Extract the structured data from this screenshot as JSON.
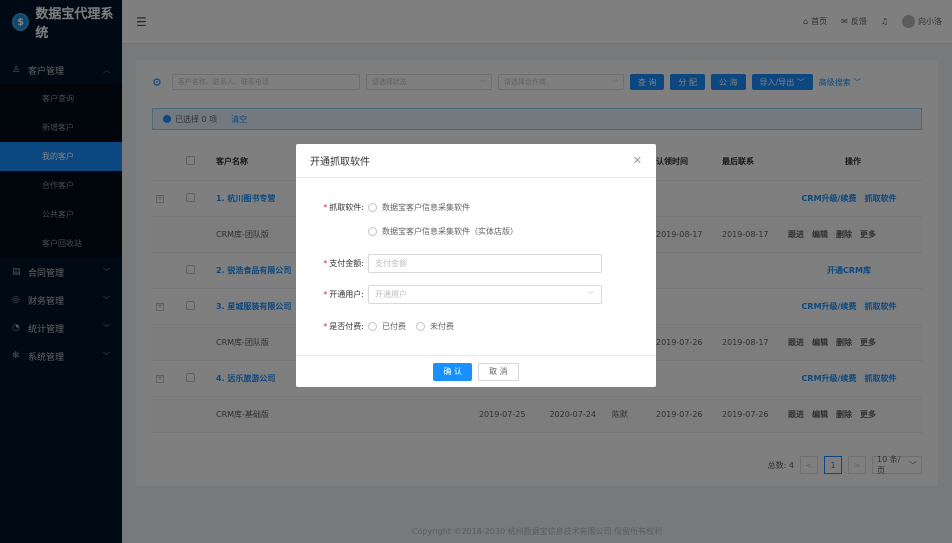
{
  "app": {
    "title": "数据宝代理系统",
    "logo_glyph": "$"
  },
  "sidebar": {
    "groups": [
      {
        "label": "客户管理",
        "icon": "user-icon",
        "expanded": true,
        "items": [
          "客户查询",
          "新增客户",
          "我的客户",
          "合作客户",
          "公共客户",
          "客户回收站"
        ],
        "active": "我的客户"
      },
      {
        "label": "合同管理",
        "icon": "contract-icon"
      },
      {
        "label": "财务管理",
        "icon": "finance-icon"
      },
      {
        "label": "统计管理",
        "icon": "stats-icon"
      },
      {
        "label": "系统管理",
        "icon": "settings-icon"
      }
    ]
  },
  "header": {
    "home_label": "首页",
    "feedback_label": "反馈",
    "username": "向小洛"
  },
  "filters": {
    "keyword_placeholder": "客户名称、联系人、联系电话",
    "status_placeholder": "请选择状态",
    "industry_placeholder": "请选择合作商",
    "query_label": "查 询",
    "assign_label": "分 配",
    "public_label": "公 海",
    "import_export_label": "导入/导出",
    "advanced_search_label": "高级搜索"
  },
  "selection": {
    "text": "已选择 0 项",
    "clear_label": "清空"
  },
  "table": {
    "headers": [
      "客户名称",
      "认领时间",
      "最后联系",
      "操作"
    ],
    "rows": [
      {
        "name": "1. 杭川图书专营",
        "ops": [
          "CRM升级/续费",
          "抓取软件"
        ],
        "sub": {
          "tier": "CRM库-团队版",
          "claim": "2019-08-17",
          "last": "2019-08-17",
          "ops": [
            "跟进",
            "编辑",
            "删除",
            "更多"
          ]
        }
      },
      {
        "name": "2. 锐浩食品有限公司",
        "ops": [
          "开通CRM库"
        ],
        "sub": null
      },
      {
        "name": "3. 星城服装有限公司",
        "ops": [
          "CRM升级/续费",
          "抓取软件"
        ],
        "sub": {
          "tier": "CRM库-团队版",
          "claim": "2019-07-26",
          "last": "2019-08-17",
          "ops": [
            "跟进",
            "编辑",
            "删除",
            "更多"
          ]
        }
      },
      {
        "name": "4. 远乐旅游公司",
        "ops": [
          "CRM升级/续费",
          "抓取软件"
        ],
        "sub": {
          "tier": "CRM库-基础版",
          "start": "2019-07-25",
          "end": "2020-07-24",
          "owner": "陈默",
          "claim": "2019-07-26",
          "last": "2019-07-26",
          "ops": [
            "跟进",
            "编辑",
            "删除",
            "更多"
          ]
        }
      }
    ]
  },
  "pager": {
    "total": "总数: 4",
    "current": "1",
    "page_size": "10 条/页"
  },
  "footer": "Copyright ©2018-2030 杭州数据宝信息技术有限公司 保留所有权利",
  "modal": {
    "title": "开通抓取软件",
    "software_label": "抓取软件:",
    "software_options": [
      "数据宝客户信息采集软件",
      "数据宝客户信息采集软件（实体店版）"
    ],
    "amount_label": "支付金额:",
    "amount_placeholder": "支付金额",
    "user_label": "开通用户:",
    "user_placeholder": "开通用户",
    "paid_label": "是否付费:",
    "paid_options": [
      "已付费",
      "未付费"
    ],
    "confirm_label": "确 认",
    "cancel_label": "取 消"
  }
}
